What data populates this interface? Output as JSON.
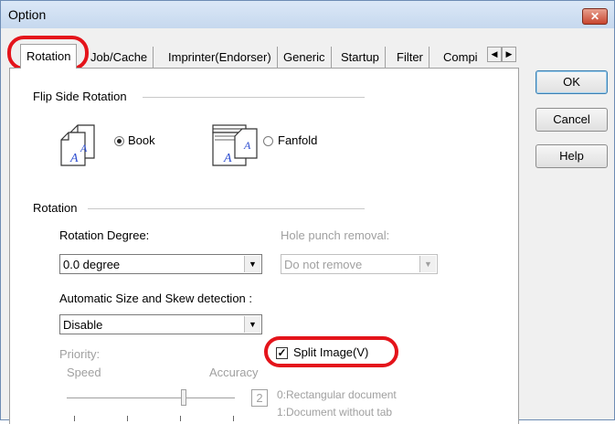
{
  "window": {
    "title": "Option",
    "close_glyph": "✕"
  },
  "tabs": [
    {
      "label": "Rotation"
    },
    {
      "label": "Job/Cache"
    },
    {
      "label": "Imprinter(Endorser)"
    },
    {
      "label": "Generic"
    },
    {
      "label": "Startup"
    },
    {
      "label": "Filter"
    },
    {
      "label": "Compi"
    }
  ],
  "tab_scroll": {
    "left": "◀",
    "right": "▶"
  },
  "buttons": {
    "ok": "OK",
    "cancel": "Cancel",
    "help": "Help"
  },
  "flip_side": {
    "title": "Flip Side Rotation",
    "book_label": "Book",
    "fanfold_label": "Fanfold",
    "selected": "Book"
  },
  "rotation": {
    "title": "Rotation",
    "degree_label": "Rotation Degree:",
    "degree_value": "0.0 degree",
    "hole_label": "Hole punch removal:",
    "hole_value": "Do not remove",
    "auto_label": "Automatic Size and Skew detection :",
    "auto_value": "Disable",
    "split_label": "Split Image(V)",
    "split_checked": true
  },
  "priority": {
    "label": "Priority:",
    "speed": "Speed",
    "accuracy": "Accuracy",
    "value": "2",
    "note1": "0:Rectangular document",
    "note2": "1:Document without tab"
  },
  "colors": {
    "highlight": "#e4141b",
    "accent": "#2f4fd0"
  }
}
